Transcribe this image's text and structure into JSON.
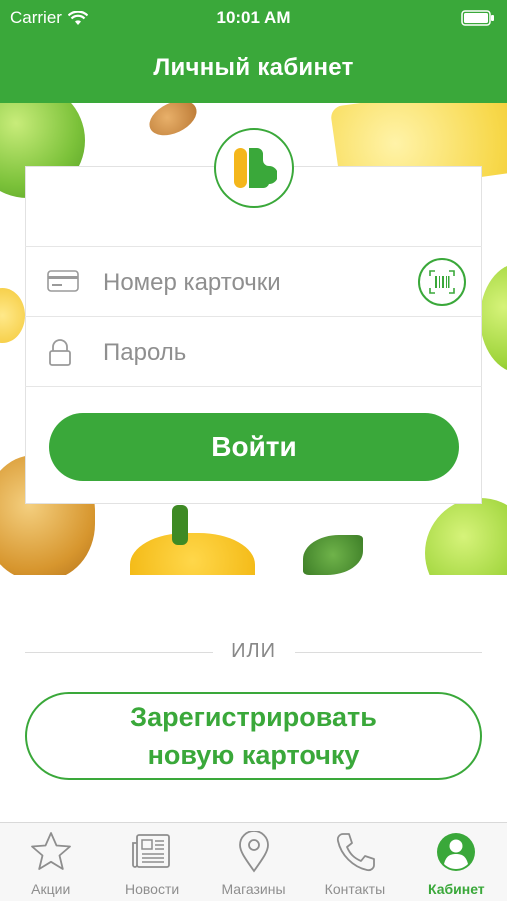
{
  "status_bar": {
    "carrier": "Carrier",
    "time": "10:01 AM"
  },
  "header": {
    "title": "Личный кабинет"
  },
  "login_form": {
    "card_number_placeholder": "Номер карточки",
    "password_placeholder": "Пароль",
    "login_label": "Войти"
  },
  "divider": {
    "text": "ИЛИ"
  },
  "register": {
    "line1": "Зарегистрировать",
    "line2": "новую карточку"
  },
  "tabbar": {
    "items": [
      {
        "label": "Акции",
        "icon": "star-icon"
      },
      {
        "label": "Новости",
        "icon": "newspaper-icon"
      },
      {
        "label": "Магазины",
        "icon": "map-pin-icon"
      },
      {
        "label": "Контакты",
        "icon": "phone-icon"
      },
      {
        "label": "Кабинет",
        "icon": "user-icon",
        "active": true
      }
    ]
  },
  "colors": {
    "accent": "#3aa83a",
    "inactive": "#8e8e8e"
  }
}
